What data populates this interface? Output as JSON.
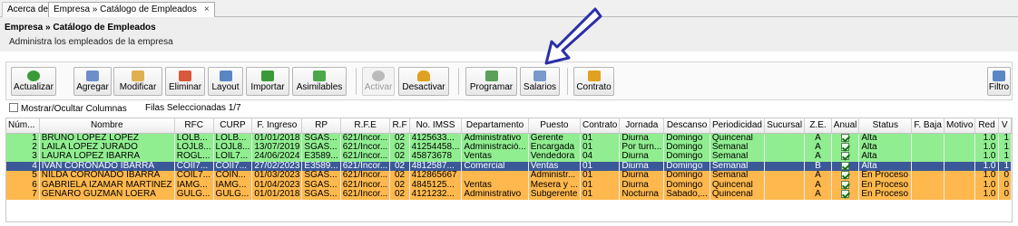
{
  "tabs": [
    {
      "label": "Acerca de"
    },
    {
      "label": "Empresa » Catálogo de Empleados",
      "close": "×"
    }
  ],
  "header": {
    "title": "Empresa » Catálogo de Empleados",
    "subtitle": "Administra los empleados de la empresa"
  },
  "toolbar": {
    "buttons": [
      {
        "label": "Actualizar",
        "icon": "refresh-icon",
        "color": "#3a9a3a"
      },
      {
        "label": "Agregar",
        "icon": "add-document-icon",
        "color": "#6d8fc9"
      },
      {
        "label": "Modificar",
        "icon": "edit-document-icon",
        "color": "#e0b050"
      },
      {
        "label": "Eliminar",
        "icon": "delete-document-icon",
        "color": "#d9573b"
      },
      {
        "label": "Layout",
        "icon": "layout-icon",
        "color": "#5b86c4"
      },
      {
        "label": "Importar",
        "icon": "import-excel-icon",
        "color": "#3a9a3a"
      },
      {
        "label": "Asimilables",
        "icon": "document-arrow-icon",
        "color": "#4aa84a"
      },
      {
        "label": "Activar",
        "icon": "activate-icon",
        "color": "#aaaaaa",
        "disabled": true
      },
      {
        "label": "Desactivar",
        "icon": "undo-arrow-icon",
        "color": "#e0a020"
      },
      {
        "label": "Programar",
        "icon": "calendar-icon",
        "color": "#5aa05a"
      },
      {
        "label": "Salarios",
        "icon": "salary-icon",
        "color": "#7a9acd"
      },
      {
        "label": "Contrato",
        "icon": "contract-icon",
        "color": "#e0a020"
      },
      {
        "label": "Filtro",
        "icon": "filter-icon",
        "color": "#5b86c4"
      }
    ]
  },
  "options": {
    "show_hide_columns": "Mostrar/Ocultar Columnas",
    "selected_rows_label": "Filas Seleccionadas",
    "selected_rows_value": "1/7"
  },
  "table": {
    "columns": [
      "Núm...",
      "Nombre",
      "RFC",
      "CURP",
      "F. Ingreso",
      "RP",
      "R.F.E",
      "R.F",
      "No. IMSS",
      "Departamento",
      "Puesto",
      "Contrato",
      "Jornada",
      "Descanso",
      "Periodicidad",
      "Sucursal",
      "Z.E.",
      "Anual",
      "Status",
      "F. Baja",
      "Motivo",
      "Red",
      "V"
    ],
    "rows": [
      {
        "status_class": "green",
        "cells": [
          "1",
          "BRUNO LOPEZ LOPEZ",
          "LOLB...",
          "LOLB...",
          "01/01/2018",
          "SGAS...",
          "621/Incor...",
          "02",
          "4125633...",
          "Administrativo",
          "Gerente",
          "01",
          "Diurna",
          "Domingo",
          "Quincenal",
          "",
          "A",
          "check",
          "Alta",
          "",
          "",
          "1.0",
          "1"
        ]
      },
      {
        "status_class": "green",
        "cells": [
          "2",
          "LAILA LOPEZ JURADO",
          "LOJL8...",
          "LOJL8...",
          "13/07/2019",
          "SGAS...",
          "621/Incor...",
          "02",
          "41254458...",
          "Administració...",
          "Encargada",
          "01",
          "Por turn...",
          "Domingo",
          "Semanal",
          "",
          "A",
          "check",
          "Alta",
          "",
          "",
          "1.0",
          "1"
        ]
      },
      {
        "status_class": "green",
        "cells": [
          "3",
          "LAURA LOPEZ IBARRA",
          "ROGL...",
          "LOIL7...",
          "24/06/2024",
          "E3589...",
          "621/Incor...",
          "02",
          "45873678",
          "Ventas",
          "Vendedora",
          "04",
          "Diurna",
          "Domingo",
          "Semanal",
          "",
          "A",
          "check",
          "Alta",
          "",
          "",
          "1.0",
          "1"
        ]
      },
      {
        "status_class": "selected",
        "cells": [
          "4",
          "IVAN CORONADO IBARRA",
          "COII7...",
          "COII7...",
          "27/02/2023",
          "E3589...",
          "621/Incor...",
          "02",
          "4812587...",
          "Comercial",
          "Ventas",
          "01",
          "Diurna",
          "Domingo",
          "Semanal",
          "",
          "B",
          "check",
          "Alta",
          "",
          "",
          "1.0",
          "1"
        ]
      },
      {
        "status_class": "orange",
        "cells": [
          "5",
          "NILDA CORONADO IBARRA",
          "COIL7...",
          "COIN...",
          "01/03/2023",
          "SGAS...",
          "621/Incor...",
          "02",
          "412865667",
          "",
          "Administr...",
          "01",
          "Diurna",
          "Domingo",
          "Semanal",
          "",
          "A",
          "check",
          "En Proceso",
          "",
          "",
          "1.0",
          "0"
        ]
      },
      {
        "status_class": "orange",
        "cells": [
          "6",
          "GABRIELA IZAMAR MARTINEZ",
          "IAMG...",
          "IAMG...",
          "01/04/2023",
          "SGAS...",
          "621/Incor...",
          "02",
          "4845125...",
          "Ventas",
          "Mesera y ...",
          "01",
          "Diurna",
          "Domingo",
          "Quincenal",
          "",
          "A",
          "check",
          "En Proceso",
          "",
          "",
          "1.0",
          "0"
        ]
      },
      {
        "status_class": "orange",
        "cells": [
          "7",
          "GENARO GUZMAN LOERA",
          "GULG...",
          "GULG...",
          "01/01/2018",
          "SGAS...",
          "621/Incor...",
          "02",
          "4121232...",
          "Administrativo",
          "Subgerente",
          "01",
          "Nocturna",
          "Sabado,...",
          "Quincenal",
          "",
          "A",
          "check",
          "En Proceso",
          "",
          "",
          "1.0",
          "0"
        ]
      }
    ]
  },
  "colors": {
    "alta_row": "#90ee90",
    "en_proceso_row": "#ffb84d",
    "selected_row": "#3b5998"
  }
}
